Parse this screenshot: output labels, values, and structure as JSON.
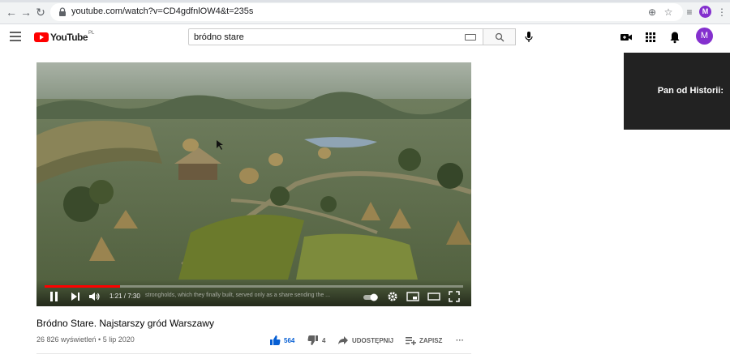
{
  "browser": {
    "url": "youtube.com/watch?v=CD4gdfnlOW4&t=235s",
    "profile_initial": "M"
  },
  "header": {
    "logo_text": "YouTube",
    "region": "PL",
    "search_query": "bródno stare",
    "avatar_initial": "M"
  },
  "player": {
    "time": "1:21 / 7:30",
    "progress": 0.18,
    "subtitle": "strongholds, which they finally built, served only as a share sending the ..."
  },
  "overlay": {
    "text": "Pan od Historii:"
  },
  "video": {
    "title": "Bródno Stare. Najstarszy gród Warszawy",
    "meta": "26 826 wyświetleń • 5 lip 2020",
    "likes": "564",
    "dislikes": "4",
    "share_label": "UDOSTĘPNIJ",
    "save_label": "ZAPISZ",
    "more_label": "···"
  },
  "colors": {
    "accent": "#065fd4",
    "brand": "#ff0000",
    "avatar": "#8430ce"
  }
}
